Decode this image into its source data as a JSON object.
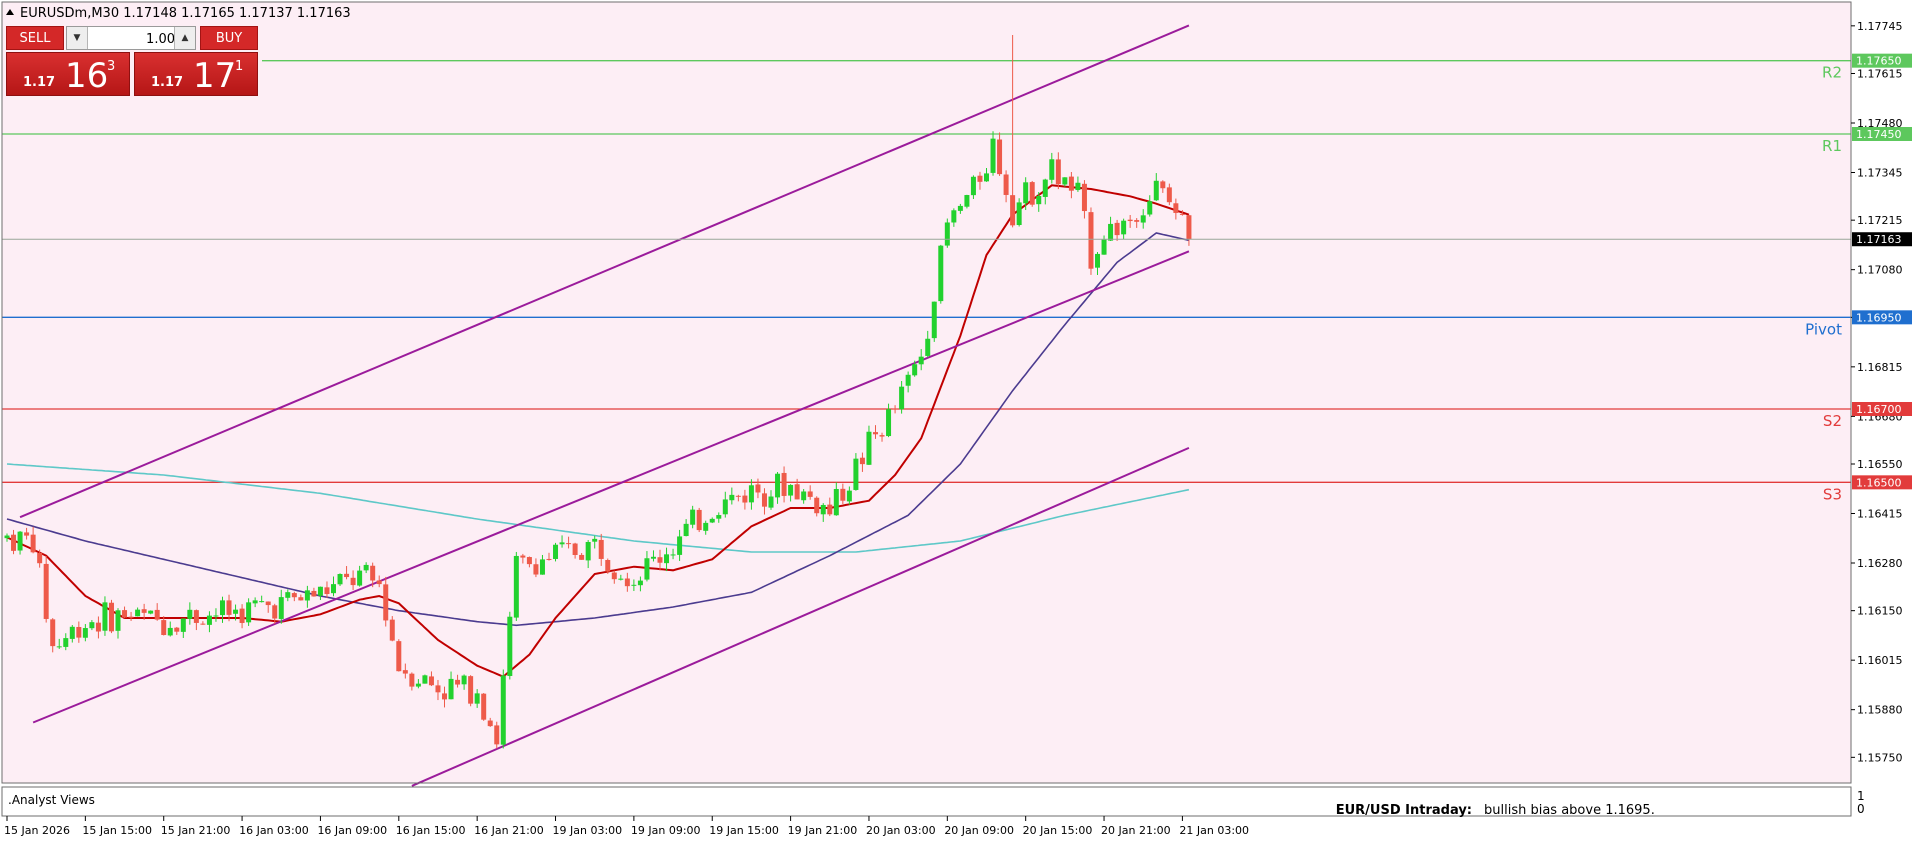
{
  "header": {
    "symbol_line": "EURUSDm,M30  1.17148 1.17165 1.17137 1.17163"
  },
  "one_click": {
    "sell_label": "SELL",
    "buy_label": "BUY",
    "volume": "1.00",
    "sell_prefix": "1.17",
    "sell_big": "16",
    "sell_sup": "3",
    "buy_prefix": "1.17",
    "buy_big": "17",
    "buy_sup": "1"
  },
  "colors": {
    "background": "#fdeef5",
    "bull": "#22d12e",
    "bear": "#ee5a4a",
    "ma_fast": "#c00000",
    "ma_slow": "#4b3b8f",
    "ma_long": "#5ec8c8",
    "channel": "#9b1b9b",
    "level_resistance": "#5dc85d",
    "level_pivot": "#1f6fcf",
    "level_support": "#e23b3b",
    "current_price_bg": "#000000"
  },
  "chart_data": {
    "type": "candlestick",
    "ylim": [
      1.1568,
      1.1781
    ],
    "y_ticks": [
      "1.17745",
      "1.17615",
      "1.17480",
      "1.17345",
      "1.17215",
      "1.17080",
      "1.16950",
      "1.16815",
      "1.16680",
      "1.16550",
      "1.16415",
      "1.16280",
      "1.16150",
      "1.16015",
      "1.15880",
      "1.15750"
    ],
    "x_ticks": [
      "15 Jan 2026",
      "15 Jan 15:00",
      "15 Jan 21:00",
      "16 Jan 03:00",
      "16 Jan 09:00",
      "16 Jan 15:00",
      "16 Jan 21:00",
      "19 Jan 03:00",
      "19 Jan 09:00",
      "19 Jan 15:00",
      "19 Jan 21:00",
      "20 Jan 03:00",
      "20 Jan 09:00",
      "20 Jan 15:00",
      "20 Jan 21:00",
      "21 Jan 03:00"
    ],
    "bars_per_tick": 12,
    "current_price": "1.17163",
    "levels": [
      {
        "name": "R2",
        "price_label": "1.17650",
        "price": 1.1765,
        "kind": "resistance"
      },
      {
        "name": "R1",
        "price_label": "1.17450",
        "price": 1.1745,
        "kind": "resistance"
      },
      {
        "name": "Pivot",
        "price_label": "1.16950",
        "price": 1.1695,
        "kind": "pivot"
      },
      {
        "name": "S2",
        "price_label": "1.16700",
        "price": 1.167,
        "kind": "support"
      },
      {
        "name": "S3",
        "price_label": "1.16500",
        "price": 1.165,
        "kind": "support"
      }
    ],
    "channel_lines": [
      {
        "from": [
          2,
          1.16405
        ],
        "to": [
          181,
          1.17746
        ]
      },
      {
        "from": [
          4,
          1.15845
        ],
        "to": [
          181,
          1.1713
        ]
      },
      {
        "from": [
          62,
          1.15672
        ],
        "to": [
          181,
          1.16594
        ]
      }
    ],
    "anchor_points": [
      [
        0,
        1.1635
      ],
      [
        4,
        1.1634
      ],
      [
        7,
        1.1605
      ],
      [
        12,
        1.1612
      ],
      [
        18,
        1.1614
      ],
      [
        24,
        1.1612
      ],
      [
        30,
        1.1614
      ],
      [
        36,
        1.1615
      ],
      [
        42,
        1.1617
      ],
      [
        48,
        1.162
      ],
      [
        54,
        1.1624
      ],
      [
        57,
        1.1622
      ],
      [
        60,
        1.16
      ],
      [
        66,
        1.1594
      ],
      [
        72,
        1.1594
      ],
      [
        75,
        1.158
      ],
      [
        78,
        1.1627
      ],
      [
        84,
        1.163
      ],
      [
        90,
        1.1633
      ],
      [
        96,
        1.1624
      ],
      [
        102,
        1.1633
      ],
      [
        108,
        1.1643
      ],
      [
        114,
        1.1648
      ],
      [
        120,
        1.1649
      ],
      [
        126,
        1.1642
      ],
      [
        132,
        1.166
      ],
      [
        136,
        1.167
      ],
      [
        140,
        1.1685
      ],
      [
        144,
        1.172
      ],
      [
        148,
        1.173
      ],
      [
        151,
        1.1742
      ],
      [
        154,
        1.1725
      ],
      [
        156,
        1.1728
      ],
      [
        160,
        1.1735
      ],
      [
        164,
        1.1728
      ],
      [
        166,
        1.1712
      ],
      [
        168,
        1.1718
      ],
      [
        172,
        1.1722
      ],
      [
        176,
        1.173
      ],
      [
        179,
        1.1724
      ],
      [
        181,
        1.17163
      ]
    ],
    "spike_high": [
      154,
      1.1772
    ],
    "ma_fast_points": [
      [
        0,
        1.1635
      ],
      [
        6,
        1.163
      ],
      [
        12,
        1.1619
      ],
      [
        18,
        1.1613
      ],
      [
        24,
        1.1613
      ],
      [
        30,
        1.1613
      ],
      [
        36,
        1.1613
      ],
      [
        42,
        1.1612
      ],
      [
        48,
        1.1614
      ],
      [
        54,
        1.1618
      ],
      [
        57,
        1.1619
      ],
      [
        60,
        1.1617
      ],
      [
        66,
        1.1607
      ],
      [
        72,
        1.16
      ],
      [
        76,
        1.1597
      ],
      [
        80,
        1.1603
      ],
      [
        84,
        1.1613
      ],
      [
        90,
        1.1625
      ],
      [
        96,
        1.1627
      ],
      [
        102,
        1.1626
      ],
      [
        108,
        1.1629
      ],
      [
        114,
        1.1638
      ],
      [
        120,
        1.1643
      ],
      [
        126,
        1.1643
      ],
      [
        132,
        1.1645
      ],
      [
        136,
        1.1652
      ],
      [
        140,
        1.1662
      ],
      [
        146,
        1.169
      ],
      [
        150,
        1.1712
      ],
      [
        154,
        1.1723
      ],
      [
        160,
        1.1731
      ],
      [
        166,
        1.173
      ],
      [
        172,
        1.1728
      ],
      [
        176,
        1.1726
      ],
      [
        181,
        1.1723
      ]
    ],
    "ma_slow_points": [
      [
        0,
        1.164
      ],
      [
        12,
        1.1634
      ],
      [
        24,
        1.1629
      ],
      [
        36,
        1.1624
      ],
      [
        48,
        1.1619
      ],
      [
        60,
        1.1615
      ],
      [
        72,
        1.1612
      ],
      [
        78,
        1.1611
      ],
      [
        90,
        1.1613
      ],
      [
        102,
        1.1616
      ],
      [
        114,
        1.162
      ],
      [
        126,
        1.163
      ],
      [
        138,
        1.1641
      ],
      [
        146,
        1.1655
      ],
      [
        154,
        1.1675
      ],
      [
        162,
        1.1693
      ],
      [
        170,
        1.171
      ],
      [
        176,
        1.1718
      ],
      [
        181,
        1.1716
      ]
    ],
    "ma_long_points": [
      [
        0,
        1.1655
      ],
      [
        24,
        1.1652
      ],
      [
        48,
        1.1647
      ],
      [
        72,
        1.164
      ],
      [
        96,
        1.1634
      ],
      [
        114,
        1.1631
      ],
      [
        130,
        1.1631
      ],
      [
        146,
        1.1634
      ],
      [
        162,
        1.1641
      ],
      [
        181,
        1.1648
      ]
    ]
  },
  "indicator_panel": {
    "name": ".Analyst Views",
    "headline": "EUR/USD Intraday:",
    "text": "bullish bias above 1.1695.",
    "scale_top": "1",
    "scale_bottom": "0"
  }
}
